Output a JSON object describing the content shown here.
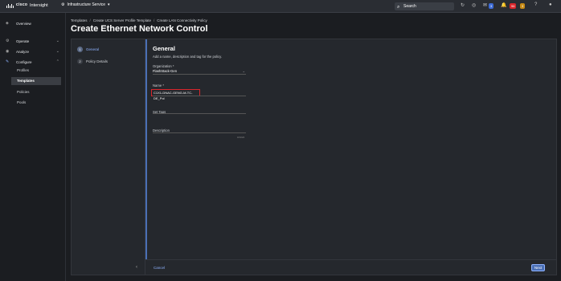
{
  "topbar": {
    "brand": "cisco",
    "app_name": "Intersight",
    "service": "Infrastructure Service",
    "search_label": "Search",
    "badges": {
      "alerts_blue": "3",
      "alarms_red": "96",
      "alarms_yellow": "3"
    }
  },
  "sidebar": {
    "overview": "Overview",
    "operate": "Operate",
    "analyze": "Analyze",
    "configure": "Configure",
    "sub_items": [
      "Profiles",
      "Templates",
      "Policies",
      "Pools"
    ]
  },
  "breadcrumb": [
    "Templates",
    "Create UCS Server Profile Template",
    "Create LAN Connectivity Policy"
  ],
  "page_title": "Create Ethernet Network Control",
  "wizard": {
    "steps": [
      {
        "num": "1",
        "label": "General"
      },
      {
        "num": "2",
        "label": "Policy Details"
      }
    ]
  },
  "form": {
    "title": "General",
    "subtitle": "Add a name, description and tag for the policy.",
    "organization_label": "Organization *",
    "organization_value": "FlashStack-Gen",
    "name_label": "Name *",
    "name_value": "C1X1-DNAC-GENG-M-TC-DE_Pol",
    "set_tags_label": "Set Tags",
    "description_label": "Description",
    "description_counter": "0/1024"
  },
  "footer": {
    "cancel": "Cancel",
    "next": "Next"
  },
  "colors": {
    "accent": "#4a6fb5",
    "highlight_border": "#d9262c",
    "link": "#8fb3ff"
  }
}
